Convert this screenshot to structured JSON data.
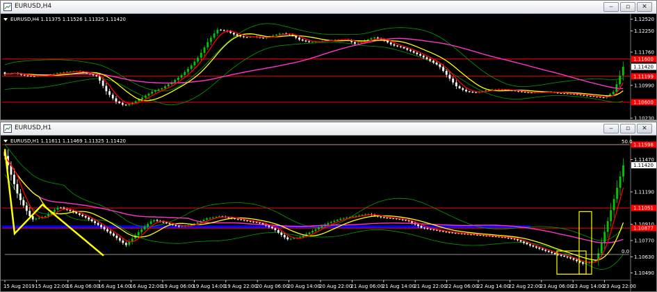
{
  "windows": {
    "h4": {
      "title": "EURUSD,H4",
      "symbol_line": "EURUSD,H4  1.11375 1.11526 1.11325 1.11420",
      "price_labels": [
        "1.12520",
        "1.12250",
        "1.11760",
        "1.10990",
        "1.10230"
      ],
      "level_tags": [
        {
          "text": "1.11420",
          "type": "current"
        },
        {
          "text": "1.11600",
          "type": "line"
        },
        {
          "text": "1.11199",
          "type": "line"
        },
        {
          "text": "1.10600",
          "type": "line"
        }
      ]
    },
    "h1": {
      "title": "EURUSD,H1",
      "symbol_line": "EURUSD,H1  1.11611 1.11469 1.11325 1.11420",
      "price_labels": [
        "1.11470",
        "1.11190",
        "1.10910",
        "1.10770",
        "1.10630",
        "1.10490"
      ],
      "level_tags": [
        {
          "text": "1.11598",
          "type": "line"
        },
        {
          "text": "1.11420",
          "type": "current"
        },
        {
          "text": "1.11051",
          "type": "line"
        },
        {
          "text": "1.10877",
          "type": "line"
        }
      ],
      "fib_labels": [
        "50.0",
        "0.0"
      ],
      "time_labels": [
        "15 Aug 2019",
        "15 Aug 22:00",
        "16 Aug 06:00",
        "16 Aug 14:00",
        "16 Aug 22:00",
        "19 Aug 06:00",
        "19 Aug 14:00",
        "19 Aug 22:00",
        "20 Aug 06:00",
        "20 Aug 14:00",
        "20 Aug 22:00",
        "21 Aug 06:00",
        "21 Aug 14:00",
        "21 Aug 22:00",
        "22 Aug 06:00",
        "22 Aug 14:00",
        "22 Aug 22:00",
        "23 Aug 06:00",
        "23 Aug 14:00",
        "23 Aug 22:00"
      ]
    }
  },
  "colors": {
    "bg": "#000000",
    "bull": "#00c800",
    "bear": "#ffffff",
    "ma_fast": "#ff0000",
    "ma_mid": "#ffff00",
    "ma_slow": "#ff33cc",
    "bands": "#00a000",
    "hline": "#ff0000",
    "zone": "#0000ff",
    "tag_bg": "#ff0000",
    "current_tag_bg": "#ffffff"
  },
  "chart_data": [
    {
      "type": "candlestick",
      "title": "EURUSD,H4",
      "ohlc_last": {
        "open": 1.11375,
        "high": 1.11526,
        "low": 1.11325,
        "close": 1.1142
      },
      "ylim": [
        1.1023,
        1.1258
      ],
      "y_ticks": [
        1.1252,
        1.1225,
        1.1176,
        1.1099,
        1.1023
      ],
      "close_series": [
        1.1125,
        1.1128,
        1.1122,
        1.112,
        1.1121,
        1.1124,
        1.1128,
        1.1131,
        1.1132,
        1.1126,
        1.112,
        1.1085,
        1.1062,
        1.1052,
        1.106,
        1.1072,
        1.1085,
        1.1092,
        1.1105,
        1.112,
        1.114,
        1.1165,
        1.12,
        1.1228,
        1.1225,
        1.1215,
        1.121,
        1.1212,
        1.1208,
        1.1214,
        1.122,
        1.1216,
        1.1204,
        1.1199,
        1.1201,
        1.1203,
        1.1205,
        1.1205,
        1.1195,
        1.1203,
        1.121,
        1.1204,
        1.1192,
        1.1187,
        1.1178,
        1.1168,
        1.1157,
        1.1145,
        1.112,
        1.1095,
        1.1085,
        1.1082,
        1.1087,
        1.109,
        1.1089,
        1.1087,
        1.1084,
        1.1082,
        1.1083,
        1.1084,
        1.1081,
        1.108,
        1.1078,
        1.1075,
        1.1073,
        1.107,
        1.1085,
        1.1142
      ],
      "horizontal_lines": [
        1.116,
        1.11199,
        1.106
      ],
      "current_price": 1.1142
    },
    {
      "type": "candlestick",
      "title": "EURUSD,H1",
      "ohlc_last": {
        "open": 1.11611,
        "high": 1.11469,
        "low": 1.11325,
        "close": 1.1142
      },
      "ylim": [
        1.1044,
        1.1164
      ],
      "y_ticks": [
        1.1147,
        1.1119,
        1.1091,
        1.1077,
        1.1063,
        1.1049
      ],
      "x_labels": [
        "15 Aug 2019",
        "15 Aug 22:00",
        "16 Aug 06:00",
        "16 Aug 14:00",
        "16 Aug 22:00",
        "19 Aug 06:00",
        "19 Aug 14:00",
        "19 Aug 22:00",
        "20 Aug 06:00",
        "20 Aug 14:00",
        "20 Aug 22:00",
        "21 Aug 06:00",
        "21 Aug 14:00",
        "21 Aug 22:00",
        "22 Aug 06:00",
        "22 Aug 14:00",
        "22 Aug 22:00",
        "23 Aug 06:00",
        "23 Aug 14:00",
        "23 Aug 22:00"
      ],
      "close_series": [
        1.115,
        1.1115,
        1.1095,
        1.1098,
        1.1106,
        1.1102,
        1.1097,
        1.109,
        1.1082,
        1.1073,
        1.1085,
        1.1095,
        1.1092,
        1.1089,
        1.1091,
        1.1096,
        1.1098,
        1.1096,
        1.1094,
        1.1092,
        1.1087,
        1.1078,
        1.108,
        1.1086,
        1.1092,
        1.1096,
        1.1098,
        1.11,
        1.1097,
        1.1096,
        1.1094,
        1.1088,
        1.1086,
        1.1084,
        1.1083,
        1.1082,
        1.1081,
        1.108,
        1.1078,
        1.1073,
        1.1069,
        1.1065,
        1.1062,
        1.1057,
        1.106,
        1.11,
        1.1142
      ],
      "horizontal_lines": [
        1.11598,
        1.11051,
        1.10877
      ],
      "blue_zone": [
        1.1088,
        1.109
      ],
      "current_price": 1.1142,
      "fibonacci": {
        "levels": [
          "50.0",
          "0.0"
        ],
        "prices": [
          1.11598,
          1.1065
        ]
      }
    }
  ]
}
